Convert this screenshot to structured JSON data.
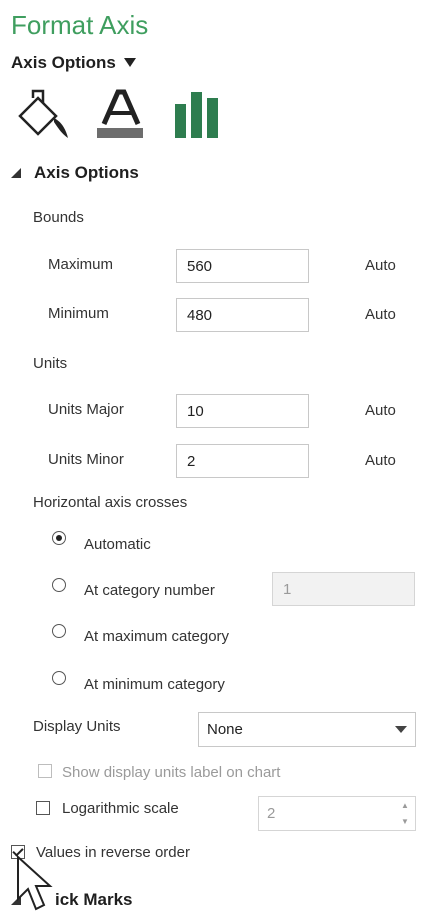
{
  "pane": {
    "title": "Format Axis"
  },
  "section_dropdown": {
    "label": "Axis Options",
    "icon": "triangle-down-icon"
  },
  "tabs": [
    {
      "name": "fill-line-tab",
      "icon": "paint-bucket-icon"
    },
    {
      "name": "text-options-tab",
      "icon": "text-a-icon"
    },
    {
      "name": "axis-options-tab",
      "icon": "bar-chart-icon"
    }
  ],
  "group": {
    "label": "Axis Options",
    "expanded": true
  },
  "bounds": {
    "heading": "Bounds",
    "maximum": {
      "label": "Maximum",
      "value": "560",
      "reset": "Auto"
    },
    "minimum": {
      "label": "Minimum",
      "value": "480",
      "reset": "Auto"
    }
  },
  "units": {
    "heading": "Units",
    "major": {
      "label": "Units Major",
      "value": "10",
      "reset": "Auto"
    },
    "minor": {
      "label": "Units Minor",
      "value": "2",
      "reset": "Auto"
    }
  },
  "crosses": {
    "heading": "Horizontal axis crosses",
    "options": [
      {
        "label": "Automatic",
        "selected": true
      },
      {
        "label": "At category number",
        "selected": false,
        "value": "1"
      },
      {
        "label": "At maximum category",
        "selected": false
      },
      {
        "label": "At minimum category",
        "selected": false
      }
    ]
  },
  "display_units": {
    "label": "Display Units",
    "selected": "None",
    "show_label": {
      "label": "Show display units label on chart",
      "checked": false,
      "enabled": false
    }
  },
  "log_scale": {
    "label": "Logarithmic scale",
    "checked": false,
    "base": "2"
  },
  "reverse_order": {
    "label": "Values in reverse order",
    "checked": true
  },
  "next_group": {
    "label": "Tick Marks",
    "visible_label": "ick Marks"
  },
  "colors": {
    "title": "#3f9e5f",
    "icon": "#2e7d4f",
    "text": "#333333"
  }
}
